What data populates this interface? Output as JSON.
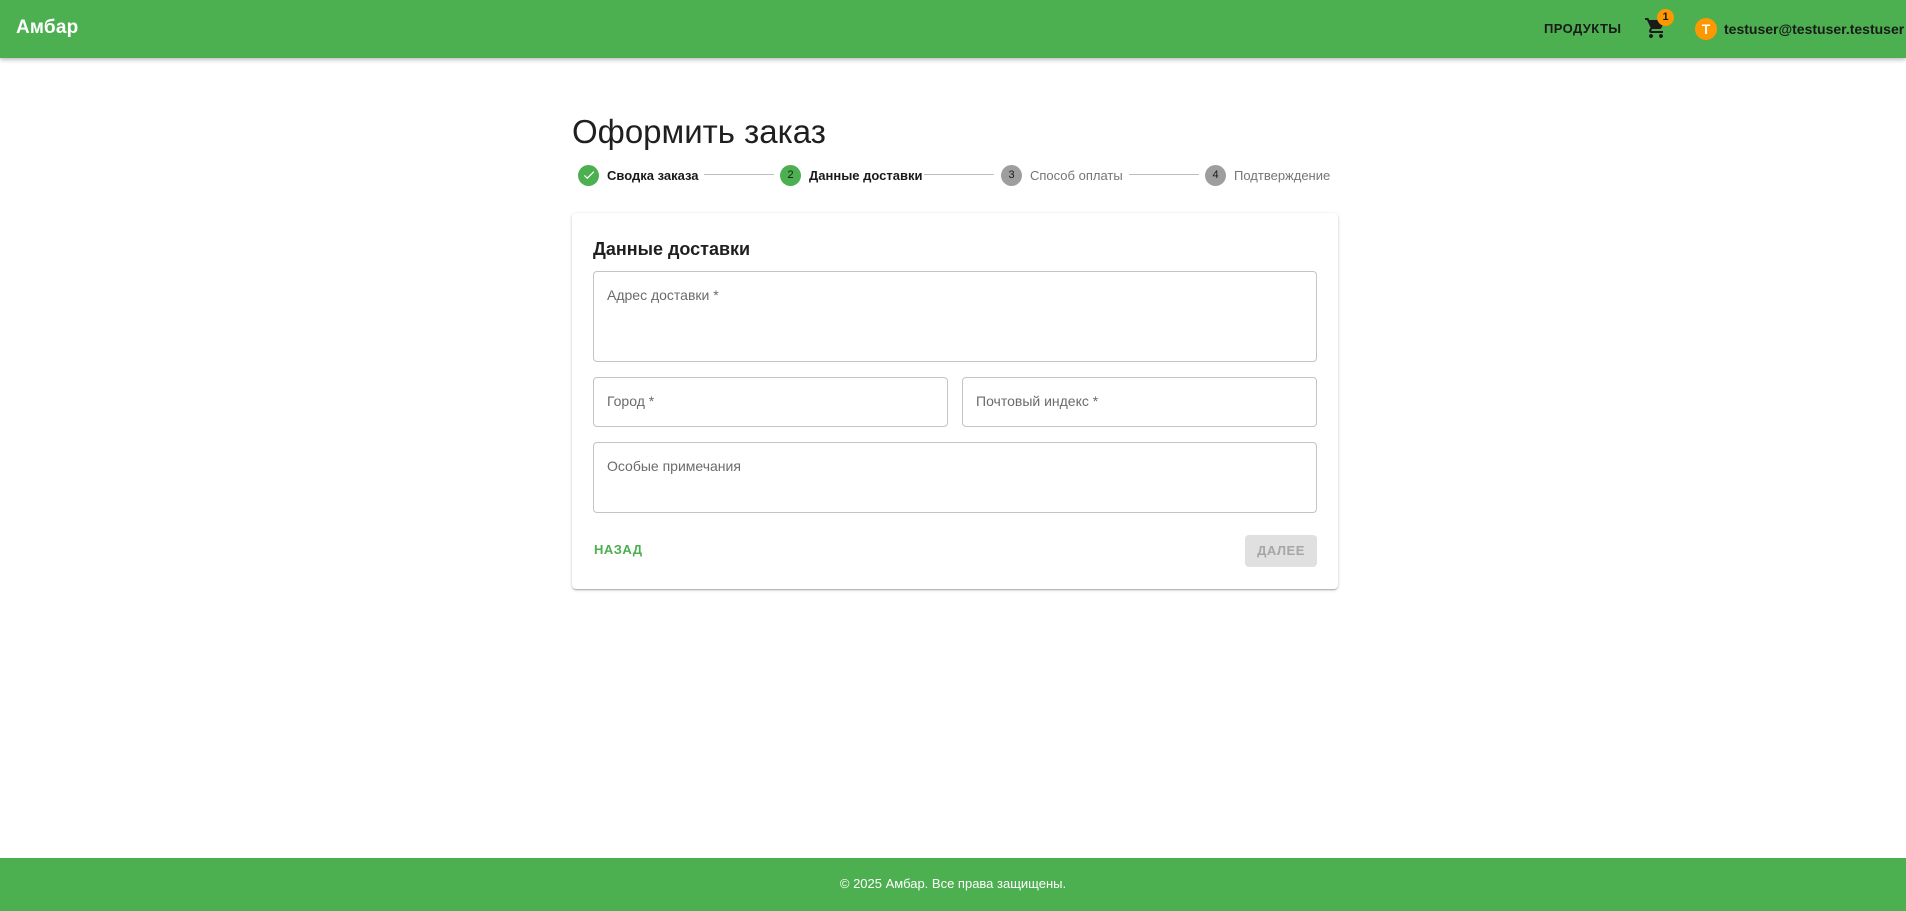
{
  "header": {
    "brand": "Амбар",
    "products_label": "ПРОДУКТЫ",
    "cart_icon": "shopping-cart-icon",
    "cart_count": "1",
    "user_initial": "T",
    "user_email": "testuser@testuser.testuser"
  },
  "page": {
    "title": "Оформить заказ"
  },
  "stepper": {
    "steps": [
      {
        "label": "Сводка заказа",
        "number": "",
        "state": "completed"
      },
      {
        "label": "Данные доставки",
        "number": "2",
        "state": "active"
      },
      {
        "label": "Способ оплаты",
        "number": "3",
        "state": "pending"
      },
      {
        "label": "Подтверждение",
        "number": "4",
        "state": "pending"
      }
    ]
  },
  "form": {
    "title": "Данные доставки",
    "address_label": "Адрес доставки *",
    "address_value": "",
    "city_label": "Город *",
    "city_value": "",
    "postal_label": "Почтовый индекс *",
    "postal_value": "",
    "notes_label": "Особые примечания",
    "notes_value": "",
    "back_label": "НАЗАД",
    "next_label": "ДАЛЕЕ"
  },
  "footer": {
    "text": "© 2025 Амбар. Все права защищены."
  },
  "colors": {
    "primary": "#4caf50",
    "accent": "#ff9800",
    "inactive_step": "#9e9e9e",
    "disabled_button": "#e0e0e0"
  }
}
